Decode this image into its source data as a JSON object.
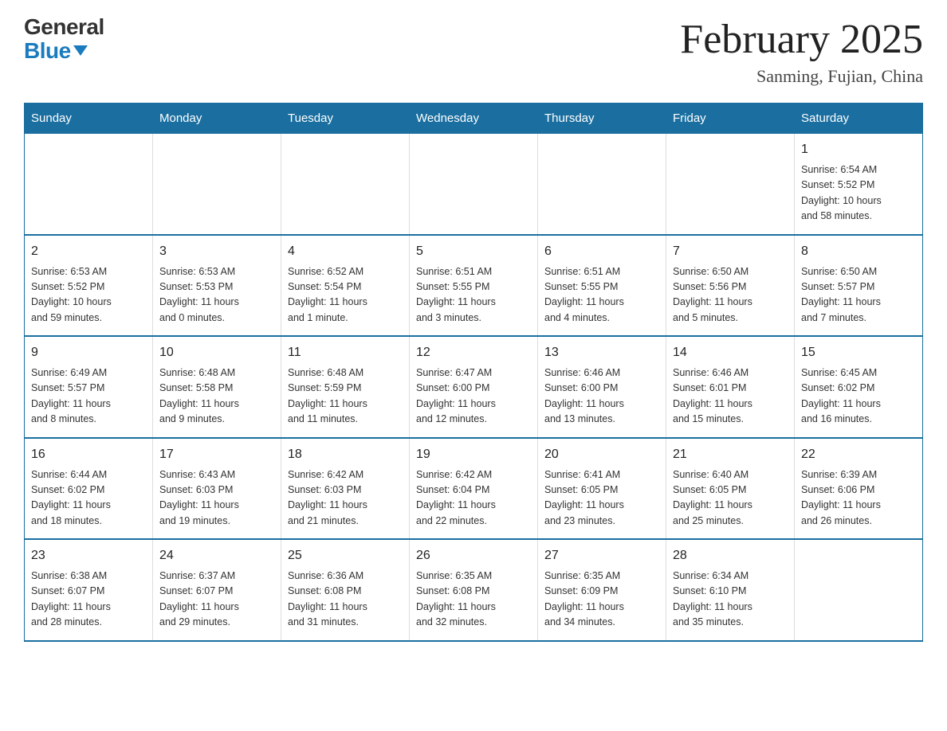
{
  "header": {
    "logo_general": "General",
    "logo_blue": "Blue",
    "month_title": "February 2025",
    "location": "Sanming, Fujian, China"
  },
  "calendar": {
    "days_of_week": [
      "Sunday",
      "Monday",
      "Tuesday",
      "Wednesday",
      "Thursday",
      "Friday",
      "Saturday"
    ],
    "weeks": [
      [
        {
          "day": "",
          "info": ""
        },
        {
          "day": "",
          "info": ""
        },
        {
          "day": "",
          "info": ""
        },
        {
          "day": "",
          "info": ""
        },
        {
          "day": "",
          "info": ""
        },
        {
          "day": "",
          "info": ""
        },
        {
          "day": "1",
          "info": "Sunrise: 6:54 AM\nSunset: 5:52 PM\nDaylight: 10 hours\nand 58 minutes."
        }
      ],
      [
        {
          "day": "2",
          "info": "Sunrise: 6:53 AM\nSunset: 5:52 PM\nDaylight: 10 hours\nand 59 minutes."
        },
        {
          "day": "3",
          "info": "Sunrise: 6:53 AM\nSunset: 5:53 PM\nDaylight: 11 hours\nand 0 minutes."
        },
        {
          "day": "4",
          "info": "Sunrise: 6:52 AM\nSunset: 5:54 PM\nDaylight: 11 hours\nand 1 minute."
        },
        {
          "day": "5",
          "info": "Sunrise: 6:51 AM\nSunset: 5:55 PM\nDaylight: 11 hours\nand 3 minutes."
        },
        {
          "day": "6",
          "info": "Sunrise: 6:51 AM\nSunset: 5:55 PM\nDaylight: 11 hours\nand 4 minutes."
        },
        {
          "day": "7",
          "info": "Sunrise: 6:50 AM\nSunset: 5:56 PM\nDaylight: 11 hours\nand 5 minutes."
        },
        {
          "day": "8",
          "info": "Sunrise: 6:50 AM\nSunset: 5:57 PM\nDaylight: 11 hours\nand 7 minutes."
        }
      ],
      [
        {
          "day": "9",
          "info": "Sunrise: 6:49 AM\nSunset: 5:57 PM\nDaylight: 11 hours\nand 8 minutes."
        },
        {
          "day": "10",
          "info": "Sunrise: 6:48 AM\nSunset: 5:58 PM\nDaylight: 11 hours\nand 9 minutes."
        },
        {
          "day": "11",
          "info": "Sunrise: 6:48 AM\nSunset: 5:59 PM\nDaylight: 11 hours\nand 11 minutes."
        },
        {
          "day": "12",
          "info": "Sunrise: 6:47 AM\nSunset: 6:00 PM\nDaylight: 11 hours\nand 12 minutes."
        },
        {
          "day": "13",
          "info": "Sunrise: 6:46 AM\nSunset: 6:00 PM\nDaylight: 11 hours\nand 13 minutes."
        },
        {
          "day": "14",
          "info": "Sunrise: 6:46 AM\nSunset: 6:01 PM\nDaylight: 11 hours\nand 15 minutes."
        },
        {
          "day": "15",
          "info": "Sunrise: 6:45 AM\nSunset: 6:02 PM\nDaylight: 11 hours\nand 16 minutes."
        }
      ],
      [
        {
          "day": "16",
          "info": "Sunrise: 6:44 AM\nSunset: 6:02 PM\nDaylight: 11 hours\nand 18 minutes."
        },
        {
          "day": "17",
          "info": "Sunrise: 6:43 AM\nSunset: 6:03 PM\nDaylight: 11 hours\nand 19 minutes."
        },
        {
          "day": "18",
          "info": "Sunrise: 6:42 AM\nSunset: 6:03 PM\nDaylight: 11 hours\nand 21 minutes."
        },
        {
          "day": "19",
          "info": "Sunrise: 6:42 AM\nSunset: 6:04 PM\nDaylight: 11 hours\nand 22 minutes."
        },
        {
          "day": "20",
          "info": "Sunrise: 6:41 AM\nSunset: 6:05 PM\nDaylight: 11 hours\nand 23 minutes."
        },
        {
          "day": "21",
          "info": "Sunrise: 6:40 AM\nSunset: 6:05 PM\nDaylight: 11 hours\nand 25 minutes."
        },
        {
          "day": "22",
          "info": "Sunrise: 6:39 AM\nSunset: 6:06 PM\nDaylight: 11 hours\nand 26 minutes."
        }
      ],
      [
        {
          "day": "23",
          "info": "Sunrise: 6:38 AM\nSunset: 6:07 PM\nDaylight: 11 hours\nand 28 minutes."
        },
        {
          "day": "24",
          "info": "Sunrise: 6:37 AM\nSunset: 6:07 PM\nDaylight: 11 hours\nand 29 minutes."
        },
        {
          "day": "25",
          "info": "Sunrise: 6:36 AM\nSunset: 6:08 PM\nDaylight: 11 hours\nand 31 minutes."
        },
        {
          "day": "26",
          "info": "Sunrise: 6:35 AM\nSunset: 6:08 PM\nDaylight: 11 hours\nand 32 minutes."
        },
        {
          "day": "27",
          "info": "Sunrise: 6:35 AM\nSunset: 6:09 PM\nDaylight: 11 hours\nand 34 minutes."
        },
        {
          "day": "28",
          "info": "Sunrise: 6:34 AM\nSunset: 6:10 PM\nDaylight: 11 hours\nand 35 minutes."
        },
        {
          "day": "",
          "info": ""
        }
      ]
    ]
  }
}
